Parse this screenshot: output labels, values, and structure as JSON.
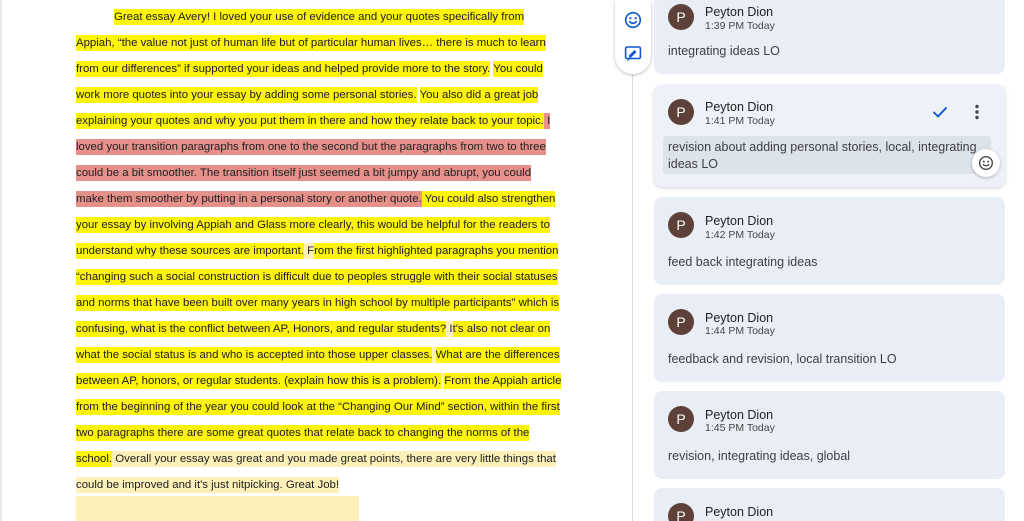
{
  "document": {
    "segments": [
      {
        "text": "Great essay Avery! I loved your use of evidence and your quotes specifically from Appiah, “the value not just of human life but of particular human lives… there is much to learn from our differences” if supported your ideas and helped provide more to the story.",
        "style": "yellow"
      },
      {
        "text": " ",
        "style": "plain"
      },
      {
        "text": "You could work more quotes into your essay by adding some personal stories.",
        "style": "yellow"
      },
      {
        "text": " ",
        "style": "plain"
      },
      {
        "text": "You also did a great job explaining your quotes and why you put them in there and how they relate back to your topic.",
        "style": "yellow"
      },
      {
        "text": " I loved your transition paragraphs from one to the second but the paragraphs from two to three could be a bit smoother. The transition itself just seemed a bit jumpy and abrupt, you could make them smoother by putting in a personal story or another quote.",
        "style": "red"
      },
      {
        "text": " You could also strengthen your essay by involving Appiah and Glass more clearly, this would be helpful for the readers to understand why these sources are important.",
        "style": "yellow"
      },
      {
        "text": " F",
        "style": "pale"
      },
      {
        "text": "rom the first highlighted paragraphs you mention “changing such a social construction is difficult due to peoples struggle with their social statuses and norms that have been built over many years in high school by multiple participants” which is confusing, what is the conflict between AP, Honors, and regular students?",
        "style": "yellow"
      },
      {
        "text": " I",
        "style": "pale"
      },
      {
        "text": "t's also not clear on what the social status is and who is accepted into those upper classes.",
        "style": "yellow"
      },
      {
        "text": " ",
        "style": "pale"
      },
      {
        "text": "What are the differences between AP, honors, or regular students. (explain how this is a problem).",
        "style": "yellow"
      },
      {
        "text": " ",
        "style": "pale"
      },
      {
        "text": "From the Appiah article from the beginning of the year you could look at the “Changing Our Mind” section, within the first two paragraphs there are some great quotes that relate back to changing the norms of the school.",
        "style": "yellow"
      },
      {
        "text": "  Overall your essay was great and you made great points, there are very little things that could be improved and it's just nitpicking. Great Job!",
        "style": "pale"
      }
    ]
  },
  "toolbar": {
    "icons": [
      "emoji-reaction-icon",
      "suggest-edit-icon"
    ]
  },
  "comments": [
    {
      "author": "Peyton Dion",
      "avatar": "P",
      "time": "1:39 PM Today",
      "text": "integrating ideas LO"
    },
    {
      "author": "Peyton Dion",
      "avatar": "P",
      "time": "1:41 PM Today",
      "text": "revision about adding personal stories, local, integrating ideas LO",
      "active": true
    },
    {
      "author": "Peyton Dion",
      "avatar": "P",
      "time": "1:42 PM Today",
      "text": "feed back integrating ideas"
    },
    {
      "author": "Peyton Dion",
      "avatar": "P",
      "time": "1:44 PM Today",
      "text": "feedback and revision, local transition LO"
    },
    {
      "author": "Peyton Dion",
      "avatar": "P",
      "time": "1:45 PM Today",
      "text": "revision, integrating ideas, global"
    },
    {
      "author": "Peyton Dion",
      "avatar": "P",
      "time": "",
      "text": ""
    }
  ],
  "colors": {
    "highlight_yellow": "#fef30a",
    "highlight_red": "#e6908a",
    "highlight_pale": "#fdf0b8",
    "avatar": "#5d4037",
    "accent": "#0b57d0"
  }
}
